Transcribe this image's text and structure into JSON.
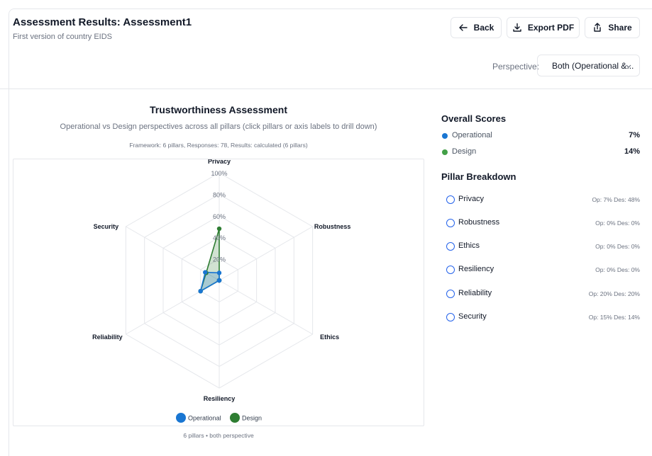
{
  "header": {
    "title": "Assessment Results: Assessment1",
    "subtitle": "First version of country EIDS",
    "back_label": "Back",
    "export_label": "Export PDF",
    "share_label": "Share",
    "perspective_label": "Perspective:",
    "perspective_value": "Both (Operational &..."
  },
  "chart_header": {
    "title": "Trustworthiness Assessment",
    "subtitle": "Operational vs Design perspectives across all pillars (click pillars or axis labels to drill down)",
    "meta": "Framework: 6 pillars, Responses: 78, Results: calculated (6 pillars)",
    "footer": "6 pillars • both perspective"
  },
  "chart_data": {
    "type": "radar",
    "categories": [
      "Privacy",
      "Robustness",
      "Ethics",
      "Resiliency",
      "Reliability",
      "Security"
    ],
    "series": [
      {
        "name": "Operational",
        "values": [
          7,
          0,
          0,
          0,
          20,
          15
        ],
        "color": "#1976d2"
      },
      {
        "name": "Design",
        "values": [
          48,
          0,
          0,
          0,
          20,
          14
        ],
        "color": "#2e7d32"
      }
    ],
    "ticks": [
      "20%",
      "40%",
      "60%",
      "80%",
      "100%"
    ],
    "rlim": [
      0,
      100
    ],
    "grid": true,
    "legend": "bottom"
  },
  "overall": {
    "title": "Overall Scores",
    "items": [
      {
        "label": "Operational",
        "value": "7%",
        "color": "#1976d2"
      },
      {
        "label": "Design",
        "value": "14%",
        "color": "#43a047"
      }
    ]
  },
  "breakdown": {
    "title": "Pillar Breakdown",
    "items": [
      {
        "label": "Privacy",
        "values": "Op: 7%  Des: 48%"
      },
      {
        "label": "Robustness",
        "values": "Op: 0%  Des: 0%"
      },
      {
        "label": "Ethics",
        "values": "Op: 0%  Des: 0%"
      },
      {
        "label": "Resiliency",
        "values": "Op: 0%  Des: 0%"
      },
      {
        "label": "Reliability",
        "values": "Op: 20%  Des: 20%"
      },
      {
        "label": "Security",
        "values": "Op: 15%  Des: 14%"
      }
    ]
  }
}
